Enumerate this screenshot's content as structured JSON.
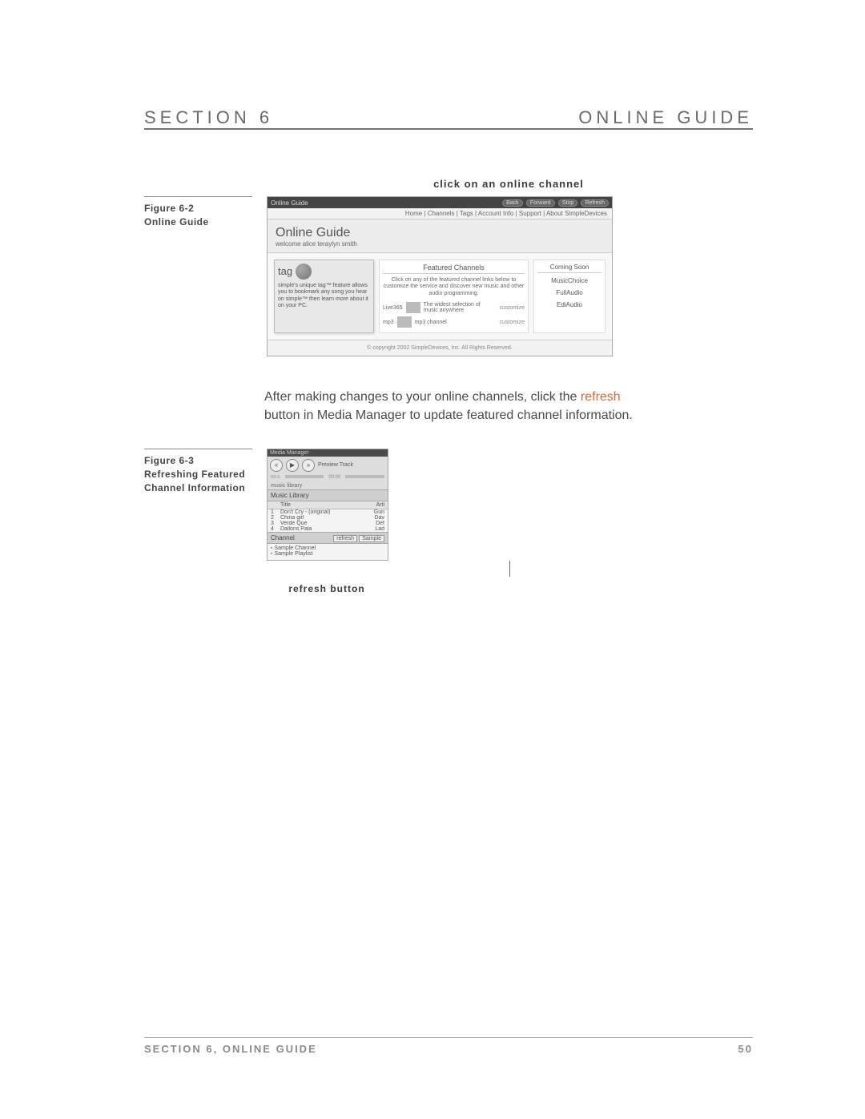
{
  "header": {
    "left": "SECTION 6",
    "right": "ONLINE GUIDE"
  },
  "caption_top": "click on an online channel",
  "figure62": {
    "sidebar_line1": "Figure 6-2",
    "sidebar_line2": "Online Guide",
    "window_title": "Online Guide",
    "nav_links": "Home | Channels | Tags | Account Info | Support | About SimpleDevices",
    "page_title": "Online Guide",
    "welcome": "welcome alice teraylyn smith",
    "tag_title": "tag",
    "tag_blurb": "simple's unique tag™ feature allows you to bookmark any song you hear on simple™ then learn more about it on your PC.",
    "featured_head": "Featured Channels",
    "featured_blurb": "Click on any of the featured channel links below to customize the service and discover new music and other audio programming.",
    "ch1_name": "Live365",
    "ch1_text": "The widest selection of music anywhere",
    "ch1_link": "customize",
    "ch2_name": "mp3",
    "ch2_text": "mp3 channel",
    "ch2_link": "customize",
    "coming_head": "Coming Soon",
    "brand1": "MusicChoice",
    "brand2": "FullAudio",
    "brand3": "EdiAudio",
    "copyright": "© copyright 2002 SimpleDevices, Inc. All Rights Reserved."
  },
  "paragraph": {
    "pre": "After making changes to your online channels, click the ",
    "refresh": "refresh",
    "post": " button in Media Manager to update featured channel information."
  },
  "figure63": {
    "sidebar_line1": "Figure 6-3",
    "sidebar_line2": "Refreshing Featured Channel Information",
    "window_title": "Media Manager",
    "track_label": "Preview Track",
    "time_left": "nn:n",
    "time_right": "00:00",
    "tab_label": "music library",
    "ml_head": "Music Library",
    "col_num": "",
    "col_title": "Title",
    "col_art": "Arti",
    "rows": [
      {
        "n": "1",
        "title": "Don't Cry - (original)",
        "art": "Gun"
      },
      {
        "n": "2",
        "title": "China girl",
        "art": "Dav"
      },
      {
        "n": "3",
        "title": "Verde Que",
        "art": "Def"
      },
      {
        "n": "4",
        "title": "Dallons Pala",
        "art": "Lad"
      }
    ],
    "channel_head": "Channel",
    "refresh_btn": "refresh",
    "sample_btn": "Sample",
    "list_item1": "Sample Channel",
    "list_item2": "Sample Playlist"
  },
  "caption_bottom": "refresh button",
  "footer": {
    "left": "SECTION 6, ONLINE GUIDE",
    "right": "50"
  }
}
